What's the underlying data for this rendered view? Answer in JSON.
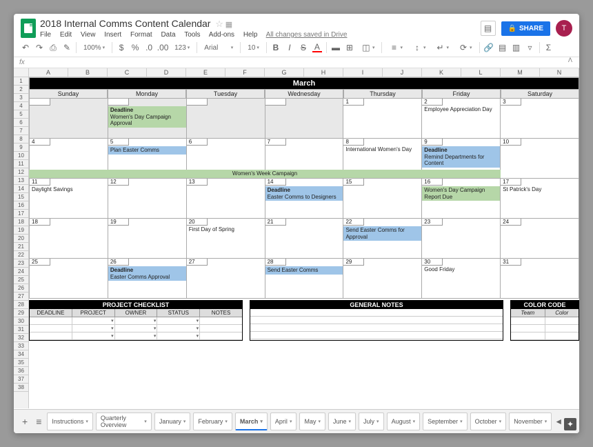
{
  "header": {
    "title": "2018 Internal Comms Content Calendar",
    "saved": "All changes saved in Drive",
    "share": "SHARE",
    "avatar": "T"
  },
  "menus": [
    "File",
    "Edit",
    "View",
    "Insert",
    "Format",
    "Data",
    "Tools",
    "Add-ons",
    "Help"
  ],
  "toolbar": {
    "zoom": "100%",
    "currency": "$",
    "percent": "%",
    "dec0": ".0",
    "dec00": ".00",
    "numfmt": "123",
    "font": "Arial",
    "size": "10"
  },
  "fx": "fx",
  "columns": [
    "A",
    "B",
    "C",
    "D",
    "E",
    "F",
    "G",
    "H",
    "I",
    "J",
    "K",
    "L",
    "M",
    "N"
  ],
  "rows": [
    "1",
    "2",
    "3",
    "4",
    "5",
    "6",
    "7",
    "8",
    "9",
    "10",
    "11",
    "12",
    "13",
    "14",
    "15",
    "16",
    "17",
    "18",
    "19",
    "20",
    "21",
    "22",
    "23",
    "24",
    "25",
    "26",
    "27",
    "28",
    "29",
    "30",
    "31",
    "32",
    "33",
    "34",
    "35",
    "36",
    "37",
    "38"
  ],
  "month": "March",
  "dow": [
    "Sunday",
    "Monday",
    "Tuesday",
    "Wednesday",
    "Thursday",
    "Friday",
    "Saturday"
  ],
  "calendar": {
    "week1": {
      "sun": {
        "date": "",
        "events": []
      },
      "mon": {
        "date": "",
        "events": [
          {
            "cls": "green",
            "bold": "Deadline",
            "text": "Women's Day Campaign Approval"
          }
        ]
      },
      "tue": {
        "date": "",
        "events": []
      },
      "wed": {
        "date": "",
        "events": []
      },
      "thu": {
        "date": "1",
        "events": []
      },
      "fri": {
        "date": "2",
        "text": "Employee Appreciation Day"
      },
      "sat": {
        "date": "3",
        "events": []
      }
    },
    "week2": {
      "sun": {
        "date": "4"
      },
      "mon": {
        "date": "5",
        "events": [
          {
            "cls": "blue",
            "text": "Plan Easter Comms"
          }
        ]
      },
      "tue": {
        "date": "6"
      },
      "wed": {
        "date": "7"
      },
      "thu": {
        "date": "8",
        "text": "International Women's Day"
      },
      "fri": {
        "date": "9",
        "events": [
          {
            "cls": "blue",
            "bold": "Deadline",
            "text": "Remind Departments for Content"
          }
        ]
      },
      "sat": {
        "date": "10"
      },
      "span": {
        "cls": "green",
        "text": "Women's Week Campaign"
      }
    },
    "week3": {
      "sun": {
        "date": "11",
        "text": "Daylight Savings"
      },
      "mon": {
        "date": "12"
      },
      "tue": {
        "date": "13"
      },
      "wed": {
        "date": "14",
        "events": [
          {
            "cls": "blue",
            "bold": "Deadline",
            "text": "Easter Comms to Designers"
          }
        ]
      },
      "thu": {
        "date": "15"
      },
      "fri": {
        "date": "16",
        "events": [
          {
            "cls": "green",
            "text": "Women's Day Campaign Report Due"
          }
        ]
      },
      "sat": {
        "date": "17",
        "text": "St Patrick's Day"
      }
    },
    "week4": {
      "sun": {
        "date": "18"
      },
      "mon": {
        "date": "19"
      },
      "tue": {
        "date": "20",
        "text": "First Day of Spring"
      },
      "wed": {
        "date": "21"
      },
      "thu": {
        "date": "22",
        "events": [
          {
            "cls": "blue",
            "text": "Send Easter Comms for Approval"
          }
        ]
      },
      "fri": {
        "date": "23"
      },
      "sat": {
        "date": "24"
      }
    },
    "week5": {
      "sun": {
        "date": "25"
      },
      "mon": {
        "date": "26",
        "events": [
          {
            "cls": "blue",
            "bold": "Deadline",
            "text": "Easter Comms Approval"
          }
        ]
      },
      "tue": {
        "date": "27"
      },
      "wed": {
        "date": "28",
        "events": [
          {
            "cls": "blue",
            "text": "Send Easter Comms"
          }
        ]
      },
      "thu": {
        "date": "29"
      },
      "fri": {
        "date": "30",
        "text": "Good Friday"
      },
      "sat": {
        "date": "31"
      }
    }
  },
  "project_checklist": {
    "title": "PROJECT CHECKLIST",
    "headers": [
      "DEADLINE",
      "PROJECT",
      "OWNER",
      "STATUS",
      "NOTES"
    ]
  },
  "general_notes": {
    "title": "GENERAL NOTES"
  },
  "color_code": {
    "title": "COLOR CODE",
    "headers": [
      "Team",
      "Color"
    ]
  },
  "tabs": [
    "Instructions",
    "Quarterly Overview",
    "January",
    "February",
    "March",
    "April",
    "May",
    "June",
    "July",
    "August",
    "September",
    "October",
    "November"
  ],
  "active_tab": "March"
}
